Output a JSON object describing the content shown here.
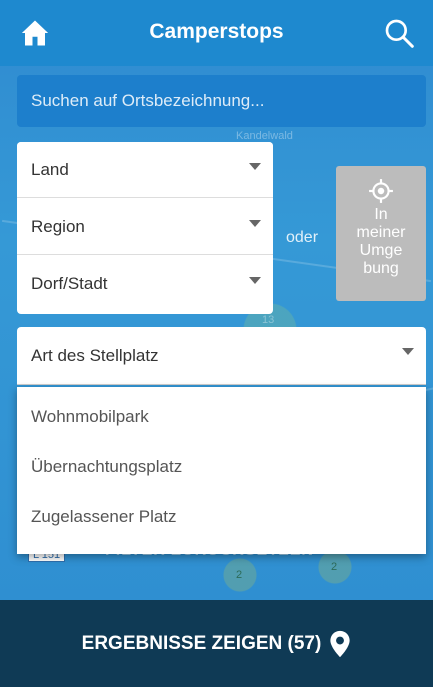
{
  "header": {
    "title": "Camperstops",
    "home_icon": "home-icon",
    "search_icon": "search-icon"
  },
  "search": {
    "placeholder": "Suchen auf Ortsbezeichnung..."
  },
  "filters": {
    "country_label": "Land",
    "region_label": "Region",
    "city_label": "Dorf/Stadt",
    "or_label": "oder",
    "nearby_label": "In\nmeiner\nUmge\nbung"
  },
  "type_dropdown": {
    "label": "Art des Stellplatz",
    "options": [
      "Wohnmobilpark",
      "Übernachtungsplatz",
      "Zugelassener Platz"
    ]
  },
  "map": {
    "place_label": "Kandelwald",
    "cluster_count": "13",
    "road_label": "L 151",
    "ghost_text": "FILTER ZURÜCKSETZEN",
    "cluster_a": "2",
    "cluster_b": "2"
  },
  "footer": {
    "label": "ERGEBNISSE ZEIGEN (57)",
    "icon": "map-pin-icon"
  },
  "colors": {
    "header": "#1e89cf",
    "footer": "#0f3a55",
    "accent": "#2f86c9",
    "disabled": "#bcbcbc"
  }
}
